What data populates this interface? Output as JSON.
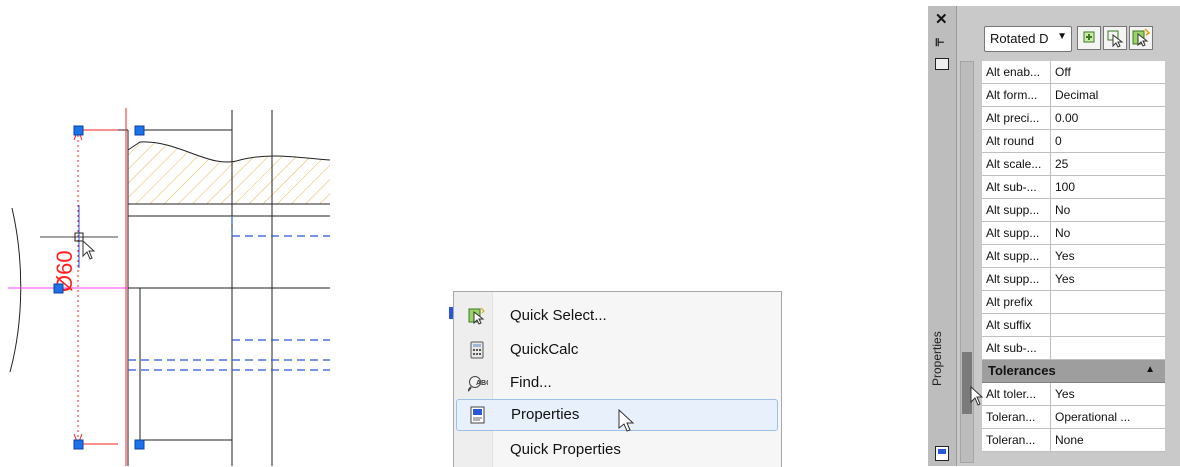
{
  "drawing": {
    "dimension_text": "Ø60",
    "colors": {
      "dimension": "#ff2020",
      "hidden_line": "#2a56d8",
      "hatch": "#e0b040",
      "grip": "#1a73e8",
      "edge": "#222222",
      "magenta": "#ff40ff"
    }
  },
  "context_menu": {
    "items": [
      {
        "label": "Quick Select...",
        "icon": "quick-select-icon"
      },
      {
        "label": "QuickCalc",
        "icon": "calculator-icon"
      },
      {
        "label": "Find...",
        "icon": "find-icon"
      },
      {
        "label": "Properties",
        "icon": "properties-icon",
        "highlighted": true
      },
      {
        "label": "Quick Properties",
        "icon": ""
      }
    ]
  },
  "palette": {
    "title": "Properties",
    "object_type": "Rotated D",
    "rows": [
      {
        "name": "Alt enab...",
        "value": "Off"
      },
      {
        "name": "Alt form...",
        "value": "Decimal"
      },
      {
        "name": "Alt preci...",
        "value": "0.00"
      },
      {
        "name": "Alt round",
        "value": "0"
      },
      {
        "name": "Alt scale...",
        "value": "25"
      },
      {
        "name": "Alt sub-...",
        "value": "100"
      },
      {
        "name": "Alt supp...",
        "value": "No"
      },
      {
        "name": "Alt supp...",
        "value": "No"
      },
      {
        "name": "Alt supp...",
        "value": "Yes"
      },
      {
        "name": "Alt supp...",
        "value": "Yes"
      },
      {
        "name": "Alt prefix",
        "value": ""
      },
      {
        "name": "Alt suffix",
        "value": ""
      },
      {
        "name": "Alt sub-...",
        "value": ""
      }
    ],
    "section": "Tolerances",
    "tolerance_rows": [
      {
        "name": "Alt toler...",
        "value": "Yes"
      },
      {
        "name": "Toleran...",
        "value": "Operational ..."
      },
      {
        "name": "Toleran...",
        "value": "None"
      }
    ]
  }
}
